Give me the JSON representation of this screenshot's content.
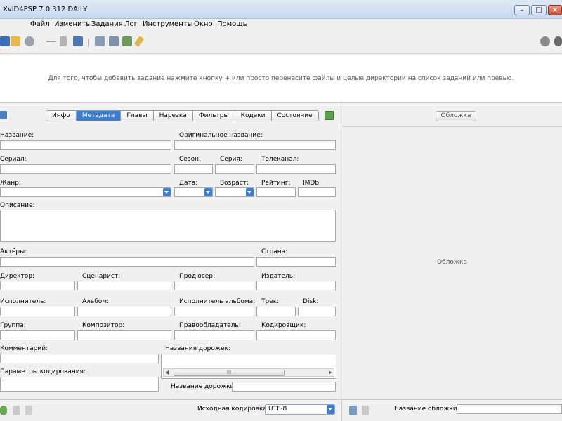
{
  "window": {
    "title": "XviD4PSP 7.0.312 DAILY",
    "minimize_glyph": "–",
    "maximize_glyph": "□",
    "close_glyph": "×"
  },
  "menu": {
    "items": [
      "Файл",
      "Изменить",
      "Задания",
      "Лог",
      "Инструменты",
      "Окно",
      "Помощь"
    ]
  },
  "toolbar": {
    "icons": [
      "save-icon",
      "open-folder-icon",
      "disc-icon",
      "remove-icon",
      "trash-icon",
      "save-task-icon",
      "copy-icon",
      "split-icon",
      "image-icon",
      "edit-pencil-icon",
      "settings-gear-icon",
      "preview-eye-icon"
    ]
  },
  "droparea": {
    "hint": "Для того, чтобы добавить задание нажмите кнопку + или просто перенесите файлы и целые директории на список заданий или превью."
  },
  "tabs": [
    {
      "label": "Инфо",
      "active": false
    },
    {
      "label": "Метадата",
      "active": true
    },
    {
      "label": "Главы",
      "active": false
    },
    {
      "label": "Нарезка",
      "active": false
    },
    {
      "label": "Фильтры",
      "active": false
    },
    {
      "label": "Кодеки",
      "active": false
    },
    {
      "label": "Состояние",
      "active": false
    }
  ],
  "labels": {
    "title": "Название:",
    "original_title": "Оригинальное название:",
    "series": "Сериал:",
    "season": "Сезон:",
    "episode": "Серия:",
    "channel": "Телеканал:",
    "genre": "Жанр:",
    "date": "Дата:",
    "age": "Возраст:",
    "rating": "Рейтинг:",
    "imdb": "IMDb:",
    "description": "Описание:",
    "actors": "Актёры:",
    "country": "Страна:",
    "director": "Директор:",
    "screenwriter": "Сценарист:",
    "producer": "Продюсер:",
    "publisher": "Издатель:",
    "performer": "Исполнитель:",
    "album": "Альбом:",
    "album_artist": "Исполнитель альбома:",
    "track": "Трек:",
    "disk": "Disk:",
    "group": "Группа:",
    "composer": "Композитор:",
    "copyright": "Правообладатель:",
    "encoder": "Кодировщик:",
    "comment": "Комментарий:",
    "track_names": "Названия дорожек:",
    "encoding_params": "Параметры кодирования:",
    "track_name": "Название дорожки:"
  },
  "scrollbar_grip": "III",
  "cover": {
    "button": "Обложка",
    "placeholder": "Обложка",
    "name_label": "Название обложки:"
  },
  "statusbar": {
    "encoding_label": "Исходная кодировка:",
    "encoding_value": "UTF-8"
  },
  "colors": {
    "accent": "#3c7fd2",
    "titlebar": "#c7d8ed",
    "close": "#c7462d"
  }
}
